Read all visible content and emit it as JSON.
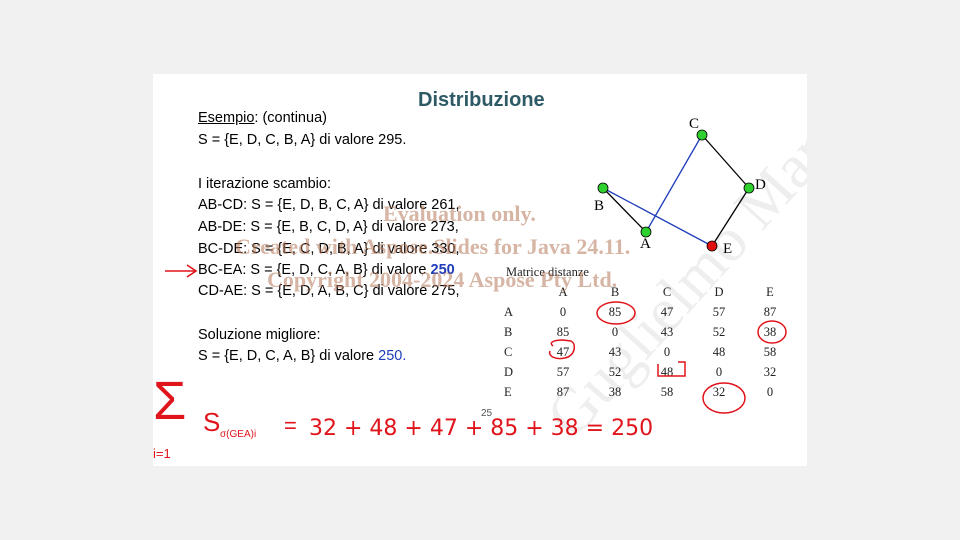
{
  "slide": {
    "title": "Distribuzione",
    "lines": {
      "example_label": "Esempio",
      "example_rest": ": (continua)",
      "s_initial": "S = {E, D, C, B, A} di valore 295.",
      "iter_title": "I iterazione scambio:",
      "ab_cd": "AB-CD: S = {E, D, B, C, A} di valore 261,",
      "ab_de": "AB-DE: S = {E, B, C, D, A} di valore 273,",
      "bc_de": "BC-DE: S = {E, C, D, B, A} di valore 330,",
      "bc_ea_prefix": "BC-EA: S = {E, D, C, A, B} di valore ",
      "bc_ea_value": "250",
      "cd_ae": "CD-AE: S = {E, D, A, B, C} di valore 275,",
      "best_title": "Soluzione migliore:",
      "best_prefix": "S = {E, D, C, A, B} di valore ",
      "best_value": "250",
      "best_suffix": ".",
      "slide_number": "25"
    },
    "graph": {
      "nodes": [
        "A",
        "B",
        "C",
        "D",
        "E"
      ]
    },
    "matrix": {
      "title": "Matrice distanze",
      "headers": [
        "A",
        "B",
        "C",
        "D",
        "E"
      ],
      "rows": [
        {
          "label": "A",
          "values": [
            "0",
            "85",
            "47",
            "57",
            "87"
          ]
        },
        {
          "label": "B",
          "values": [
            "85",
            "0",
            "43",
            "52",
            "38"
          ]
        },
        {
          "label": "C",
          "values": [
            "47",
            "43",
            "0",
            "48",
            "58"
          ]
        },
        {
          "label": "D",
          "values": [
            "57",
            "52",
            "48",
            "0",
            "32"
          ]
        },
        {
          "label": "E",
          "values": [
            "87",
            "38",
            "58",
            "32",
            "0"
          ]
        }
      ]
    },
    "annotation": {
      "sum_symbol": "Σ",
      "lower": "i=1",
      "s_sub": "S",
      "s_sub_index": "σ(GEA)i",
      "equals": "=",
      "sum_expr": "32 + 48 + 47 + 85 + 38 = 250"
    },
    "watermark": {
      "line1": "Evaluation only.",
      "line2": "Created with Aspose.Slides for Java 24.11.",
      "line3": "Copyright 2004-2024 Aspose Pty Ltd.",
      "diagonal": "Guglielmo Marc"
    },
    "colors": {
      "title": "#2e5a66",
      "node_green": "#2fd12f",
      "node_red": "#e01010",
      "edge_blue": "#1f3dbb",
      "ink_red": "#e0141b"
    }
  }
}
